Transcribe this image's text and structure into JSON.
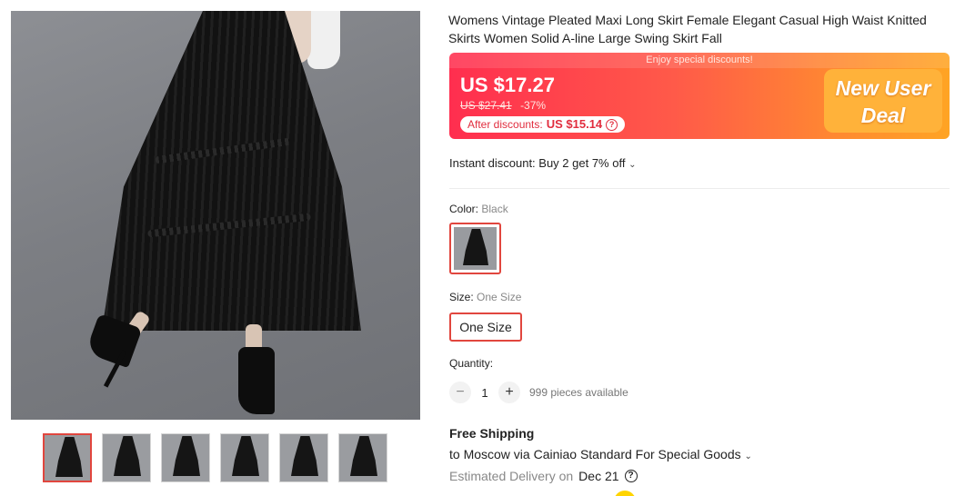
{
  "product": {
    "title": "Womens Vintage Pleated Maxi Long Skirt Female Elegant Casual High Waist Knitted Skirts Women Solid A-line Large Swing Skirt Fall"
  },
  "gallery": {
    "main_alt": "Black pleated maxi skirt",
    "thumbnail_count": 6,
    "active_thumbnail": 1
  },
  "price": {
    "banner_note": "Enjoy special discounts!",
    "current": "US $17.27",
    "original": "US $27.41",
    "discount": "-37%",
    "after_label": "After discounts:",
    "after_amount": "US $15.14",
    "promo_line1": "New User",
    "promo_line2": "Deal"
  },
  "instant_discount": "Instant discount: Buy 2 get 7% off",
  "options": {
    "color_label": "Color:",
    "color_value": "Black",
    "size_label": "Size:",
    "size_value": "One Size",
    "size_button": "One Size"
  },
  "quantity": {
    "label": "Quantity:",
    "minus": "−",
    "value": "1",
    "plus": "+",
    "available": "999 pieces available"
  },
  "shipping": {
    "title": "Free Shipping",
    "destination": "to Moscow via Cainiao Standard For Special Goods",
    "estimated_label": "Estimated Delivery on",
    "estimated_date": "Dec 21"
  },
  "colors": {
    "accent": "#e1463e",
    "banner_start": "#ff2e4f",
    "banner_end": "#ffa424"
  }
}
